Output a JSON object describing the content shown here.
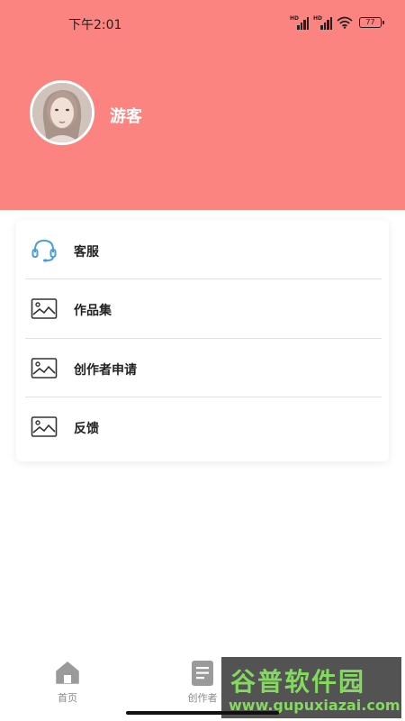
{
  "status_bar": {
    "time": "下午2:01",
    "hd_label": "HD",
    "battery": "77"
  },
  "profile": {
    "username": "游客"
  },
  "menu": {
    "items": [
      {
        "label": "客服",
        "icon": "headset-icon"
      },
      {
        "label": "作品集",
        "icon": "image-icon"
      },
      {
        "label": "创作者申请",
        "icon": "image-icon"
      },
      {
        "label": "反馈",
        "icon": "image-icon"
      }
    ]
  },
  "tabbar": {
    "tabs": [
      {
        "label": "首页",
        "icon": "home-icon"
      },
      {
        "label": "创作者",
        "icon": "document-icon"
      }
    ]
  },
  "watermark": {
    "title": "谷普软件园",
    "url": "www.gupuxiazai.com"
  },
  "colors": {
    "header_bg": "#fc8480",
    "headset_accent": "#4a9fd8",
    "watermark_green": "#7ed957"
  }
}
